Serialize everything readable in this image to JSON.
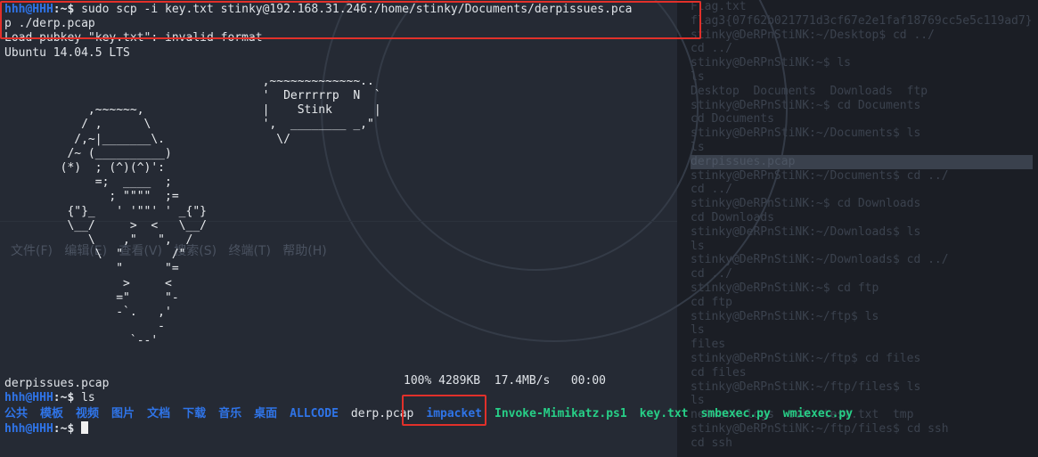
{
  "terminal": {
    "prompt_user": "hhh@HHH",
    "prompt_path": ":~$",
    "command_line_1": " sudo scp -i key.txt stinky@192.168.31.246:/home/stinky/Documents/derpissues.pca",
    "command_line_2": "p ./derp.pcap",
    "output_warning": "Load pubkey \"key.txt\": invalid format",
    "output_os": "Ubuntu 14.04.5 LTS",
    "ascii_art": "                                     ,~~~~~~~~~~~~~..\n                                     '  Derrrrrp  N  `\n            ,~~~~~~,                 |    Stink      |\n           / ,      \\                ',  ________ _,\"\n          /,~|_______\\.                \\/\n         /~ (__________)\n        (*)  ; (^)(^)':\n             =;  ____  ;\n               ; \"\"\"\"  ;=\n         {\"}_   ' '\"\"' ' _{\"}\n         \\__/     >  <   \\__/\n            \\    ,\"   \",  /\n             \\  \"       /\"\n                \"      \"=\n                 >     <\n                =\"     \"-\n                -`.   ,'\n                      -\n                  `--'",
    "transfer_file": "derpissues.pcap",
    "transfer_stats": "100% 4289KB  17.4MB/s   00:00",
    "command_ls": " ls",
    "ls_entries": [
      {
        "name": "公共",
        "kind": "dir"
      },
      {
        "name": "模板",
        "kind": "dir"
      },
      {
        "name": "视频",
        "kind": "dir"
      },
      {
        "name": "图片",
        "kind": "dir"
      },
      {
        "name": "文档",
        "kind": "dir"
      },
      {
        "name": "下载",
        "kind": "dir"
      },
      {
        "name": "音乐",
        "kind": "dir"
      },
      {
        "name": "桌面",
        "kind": "dir"
      },
      {
        "name": "ALLCODE",
        "kind": "dir"
      },
      {
        "name": "derp.pcap",
        "kind": "file"
      },
      {
        "name": "impacket",
        "kind": "dir"
      },
      {
        "name": "Invoke-Mimikatz.ps1",
        "kind": "exec"
      },
      {
        "name": "key.txt",
        "kind": "exec"
      },
      {
        "name": "smbexec.py",
        "kind": "exec"
      },
      {
        "name": "wmiexec.py",
        "kind": "exec"
      }
    ]
  },
  "background": {
    "menu_items": "文件(F)   编辑(E)   查看(V)   搜索(S)   终端(T)   帮助(H)",
    "right_lines": [
      "Flag.txt",
      "flag3{07f62b021771d3cf67e2e1faf18769cc5e5c119ad7}",
      "stinky@DeRPnStiNK:~/Desktop$ cd ../",
      "cd ../",
      "stinky@DeRPnStiNK:~$ ls",
      "ls",
      "Desktop  Documents  Downloads  ftp",
      "stinky@DeRPnStiNK:~$ cd Documents",
      "cd Documents",
      "stinky@DeRPnStiNK:~/Documents$ ls",
      "ls",
      "derpissues.pcap",
      "stinky@DeRPnStiNK:~/Documents$ cd ../",
      "cd ../",
      "stinky@DeRPnStiNK:~$ cd Downloads",
      "cd Downloads",
      "stinky@DeRPnStiNK:~/Downloads$ ls",
      "ls",
      "stinky@DeRPnStiNK:~/Downloads$ cd ../",
      "cd ../",
      "stinky@DeRPnStiNK:~$ cd ftp",
      "cd ftp",
      "stinky@DeRPnStiNK:~/ftp$ ls",
      "ls",
      "files",
      "stinky@DeRPnStiNK:~/ftp$ cd files",
      "cd files",
      "stinky@DeRPnStiNK:~/ftp/files$ ls",
      "ls",
      "network-logs  ssh  test.txt  tmp",
      "stinky@DeRPnStiNK:~/ftp/files$ cd ssh",
      "cd ssh"
    ]
  },
  "colors": {
    "accent_dir": "#2f74e8",
    "accent_exec": "#27cf87",
    "highlight_box": "#e1302a"
  }
}
